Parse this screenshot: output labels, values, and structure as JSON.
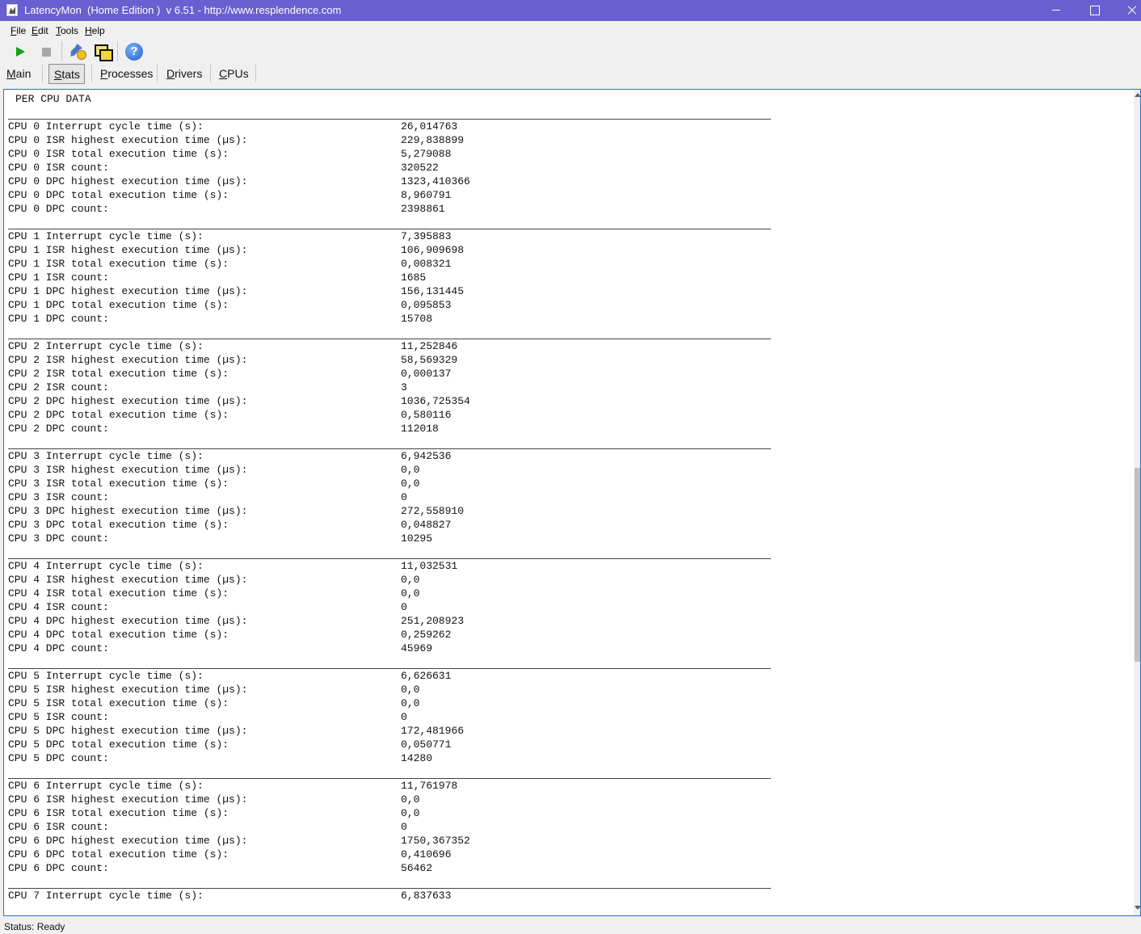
{
  "window": {
    "title": "LatencyMon  (Home Edition )  v 6.51 - http://www.resplendence.com"
  },
  "menu": {
    "file": "File",
    "edit": "Edit",
    "tools": "Tools",
    "help": "Help"
  },
  "tabs": {
    "main": "Main",
    "stats": "Stats",
    "processes": "Processes",
    "drivers": "Drivers",
    "cpus": "CPUs"
  },
  "report": {
    "heading": "PER CPU DATA",
    "cpus": [
      {
        "rows": [
          {
            "label": "CPU 0 Interrupt cycle time (s):",
            "value": "26,014763"
          },
          {
            "label": "CPU 0 ISR highest execution time (µs):",
            "value": "229,838899"
          },
          {
            "label": "CPU 0 ISR total execution time (s):",
            "value": "5,279088"
          },
          {
            "label": "CPU 0 ISR count:",
            "value": "320522"
          },
          {
            "label": "CPU 0 DPC highest execution time (µs):",
            "value": "1323,410366"
          },
          {
            "label": "CPU 0 DPC total execution time (s):",
            "value": "8,960791"
          },
          {
            "label": "CPU 0 DPC count:",
            "value": "2398861"
          }
        ]
      },
      {
        "rows": [
          {
            "label": "CPU 1 Interrupt cycle time (s):",
            "value": "7,395883"
          },
          {
            "label": "CPU 1 ISR highest execution time (µs):",
            "value": "106,909698"
          },
          {
            "label": "CPU 1 ISR total execution time (s):",
            "value": "0,008321"
          },
          {
            "label": "CPU 1 ISR count:",
            "value": "1685"
          },
          {
            "label": "CPU 1 DPC highest execution time (µs):",
            "value": "156,131445"
          },
          {
            "label": "CPU 1 DPC total execution time (s):",
            "value": "0,095853"
          },
          {
            "label": "CPU 1 DPC count:",
            "value": "15708"
          }
        ]
      },
      {
        "rows": [
          {
            "label": "CPU 2 Interrupt cycle time (s):",
            "value": "11,252846"
          },
          {
            "label": "CPU 2 ISR highest execution time (µs):",
            "value": "58,569329"
          },
          {
            "label": "CPU 2 ISR total execution time (s):",
            "value": "0,000137"
          },
          {
            "label": "CPU 2 ISR count:",
            "value": "3"
          },
          {
            "label": "CPU 2 DPC highest execution time (µs):",
            "value": "1036,725354"
          },
          {
            "label": "CPU 2 DPC total execution time (s):",
            "value": "0,580116"
          },
          {
            "label": "CPU 2 DPC count:",
            "value": "112018"
          }
        ]
      },
      {
        "rows": [
          {
            "label": "CPU 3 Interrupt cycle time (s):",
            "value": "6,942536"
          },
          {
            "label": "CPU 3 ISR highest execution time (µs):",
            "value": "0,0"
          },
          {
            "label": "CPU 3 ISR total execution time (s):",
            "value": "0,0"
          },
          {
            "label": "CPU 3 ISR count:",
            "value": "0"
          },
          {
            "label": "CPU 3 DPC highest execution time (µs):",
            "value": "272,558910"
          },
          {
            "label": "CPU 3 DPC total execution time (s):",
            "value": "0,048827"
          },
          {
            "label": "CPU 3 DPC count:",
            "value": "10295"
          }
        ]
      },
      {
        "rows": [
          {
            "label": "CPU 4 Interrupt cycle time (s):",
            "value": "11,032531"
          },
          {
            "label": "CPU 4 ISR highest execution time (µs):",
            "value": "0,0"
          },
          {
            "label": "CPU 4 ISR total execution time (s):",
            "value": "0,0"
          },
          {
            "label": "CPU 4 ISR count:",
            "value": "0"
          },
          {
            "label": "CPU 4 DPC highest execution time (µs):",
            "value": "251,208923"
          },
          {
            "label": "CPU 4 DPC total execution time (s):",
            "value": "0,259262"
          },
          {
            "label": "CPU 4 DPC count:",
            "value": "45969"
          }
        ]
      },
      {
        "rows": [
          {
            "label": "CPU 5 Interrupt cycle time (s):",
            "value": "6,626631"
          },
          {
            "label": "CPU 5 ISR highest execution time (µs):",
            "value": "0,0"
          },
          {
            "label": "CPU 5 ISR total execution time (s):",
            "value": "0,0"
          },
          {
            "label": "CPU 5 ISR count:",
            "value": "0"
          },
          {
            "label": "CPU 5 DPC highest execution time (µs):",
            "value": "172,481966"
          },
          {
            "label": "CPU 5 DPC total execution time (s):",
            "value": "0,050771"
          },
          {
            "label": "CPU 5 DPC count:",
            "value": "14280"
          }
        ]
      },
      {
        "rows": [
          {
            "label": "CPU 6 Interrupt cycle time (s):",
            "value": "11,761978"
          },
          {
            "label": "CPU 6 ISR highest execution time (µs):",
            "value": "0,0"
          },
          {
            "label": "CPU 6 ISR total execution time (s):",
            "value": "0,0"
          },
          {
            "label": "CPU 6 ISR count:",
            "value": "0"
          },
          {
            "label": "CPU 6 DPC highest execution time (µs):",
            "value": "1750,367352"
          },
          {
            "label": "CPU 6 DPC total execution time (s):",
            "value": "0,410696"
          },
          {
            "label": "CPU 6 DPC count:",
            "value": "56462"
          }
        ]
      },
      {
        "rows": [
          {
            "label": "CPU 7 Interrupt cycle time (s):",
            "value": "6,837633"
          }
        ]
      }
    ]
  },
  "status": {
    "text": "Status: Ready"
  },
  "icons": {
    "play": "play-icon",
    "stop": "stop-icon",
    "tools": "tools-icon",
    "windows": "windows-icon",
    "help": "help-icon"
  },
  "colors": {
    "titlebar": "#6a5fd0",
    "content_border": "#2f6fd0",
    "play": "#16a016"
  }
}
